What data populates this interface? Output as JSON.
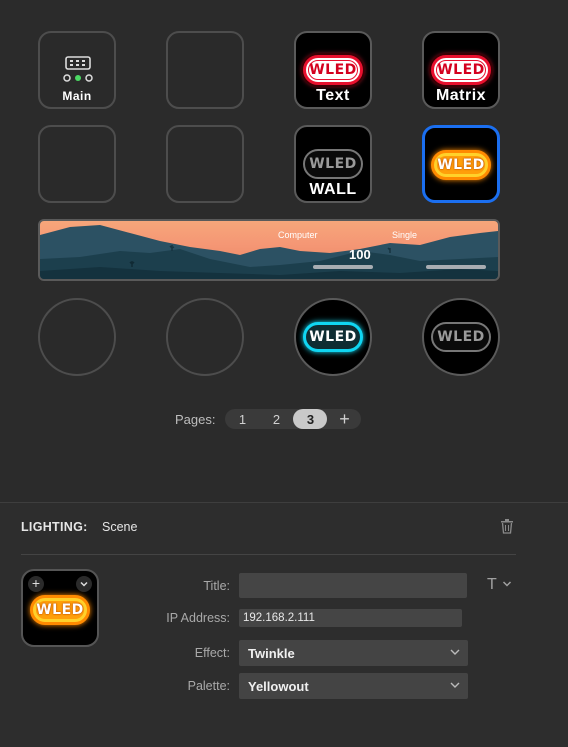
{
  "keys": {
    "main_label": "Main",
    "text_label": "Text",
    "matrix_label": "Matrix",
    "wall_label": "WALL",
    "wled_logo": "WLED"
  },
  "dial": {
    "left_caption": "Computer",
    "right_caption": "Single",
    "value": "100"
  },
  "pager": {
    "label": "Pages:",
    "pages": [
      "1",
      "2",
      "3"
    ],
    "add": "+"
  },
  "inspector": {
    "category": "LIGHTING:",
    "action": "Scene",
    "title_label": "Title:",
    "title_value": "",
    "ip_label": "IP Address:",
    "ip_value": "192.168.2.111",
    "effect_label": "Effect:",
    "effect_value": "Twinkle",
    "palette_label": "Palette:",
    "palette_value": "Yellowout",
    "font_glyph": "T",
    "preview_logo": "WLED",
    "add_glyph": "+"
  },
  "colors": {
    "accent": "#1b6ff0",
    "wled_red": "#e8102e",
    "wled_orange": "#ff8a00",
    "wled_cyan": "#10d6f2",
    "sunset": "#f59775",
    "mountains": "#1f4656"
  }
}
